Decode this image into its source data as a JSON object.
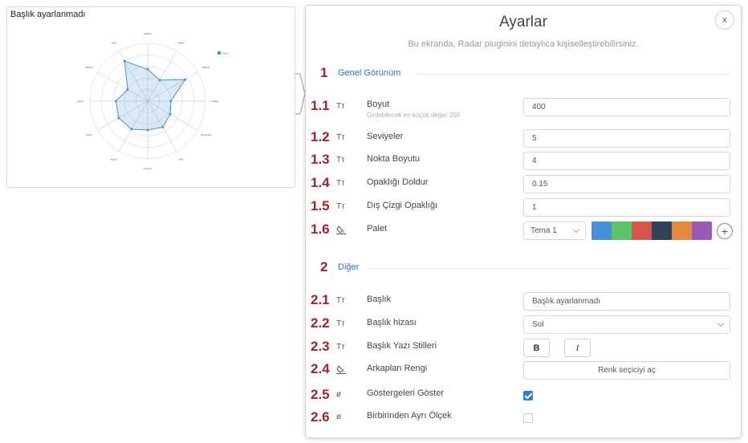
{
  "preview": {
    "title": "Başlık ayarlanmadı",
    "axes": [
      "Başlık",
      "Metin",
      "Etiket",
      "Değer",
      "Seçenek",
      "Etki",
      "Seviye",
      "Boyut",
      "Renk",
      "Çizgi",
      "Nokta",
      "Alan"
    ],
    "values": [
      0.55,
      0.42,
      0.75,
      0.4,
      0.45,
      0.52,
      0.5,
      0.56,
      0.58,
      0.55,
      0.4,
      0.8
    ],
    "legend_label": "Veri 1",
    "fill_color": "#4a90d9",
    "levels": 5
  },
  "panel": {
    "title": "Ayarlar",
    "subtitle": "Bu ekranda, Radar pluginini detaylıca kişiselleştirebilirsiniz.",
    "close_label": "x"
  },
  "section1": {
    "num": "1",
    "title": "Genel Görünüm"
  },
  "section2": {
    "num": "2",
    "title": "Diğer"
  },
  "rows": {
    "r11": {
      "num": "1.1",
      "icon": "Tт",
      "label": "Boyut",
      "hint": "Girilebilecek en küçük değer 200",
      "value": "400"
    },
    "r12": {
      "num": "1.2",
      "icon": "Tт",
      "label": "Seviyeler",
      "value": "5"
    },
    "r13": {
      "num": "1.3",
      "icon": "Tт",
      "label": "Nokta Boyutu",
      "value": "4"
    },
    "r14": {
      "num": "1.4",
      "icon": "Tт",
      "label": "Opaklığı Doldur",
      "value": "0.15"
    },
    "r15": {
      "num": "1.5",
      "icon": "Tт",
      "label": "Dış Çizgi Opaklığı",
      "value": "1"
    },
    "r16": {
      "num": "1.6",
      "label": "Palet",
      "theme": "Tema 1",
      "add": "+"
    },
    "r21": {
      "num": "2.1",
      "icon": "Tт",
      "label": "Başlık",
      "value": "Başlık ayarlanmadı"
    },
    "r22": {
      "num": "2.2",
      "icon": "Tт",
      "label": "Başlık hizası",
      "value": "Sol"
    },
    "r23": {
      "num": "2.3",
      "icon": "Tт",
      "label": "Başlık Yazı Stilleri",
      "bold": "B",
      "italic": "I"
    },
    "r24": {
      "num": "2.4",
      "label": "Arkaplan Rengi",
      "button": "Renk seçiciyi aç"
    },
    "r25": {
      "num": "2.5",
      "icon": "ø",
      "label": "Göstergeleri Göster",
      "checked": true
    },
    "r26": {
      "num": "2.6",
      "icon": "ø",
      "label": "Birbirinden Ayrı Ölçek",
      "checked": false
    }
  },
  "palette": [
    "#4a90d9",
    "#5cc36b",
    "#d9534f",
    "#344256",
    "#e8883a",
    "#9b59b6"
  ]
}
